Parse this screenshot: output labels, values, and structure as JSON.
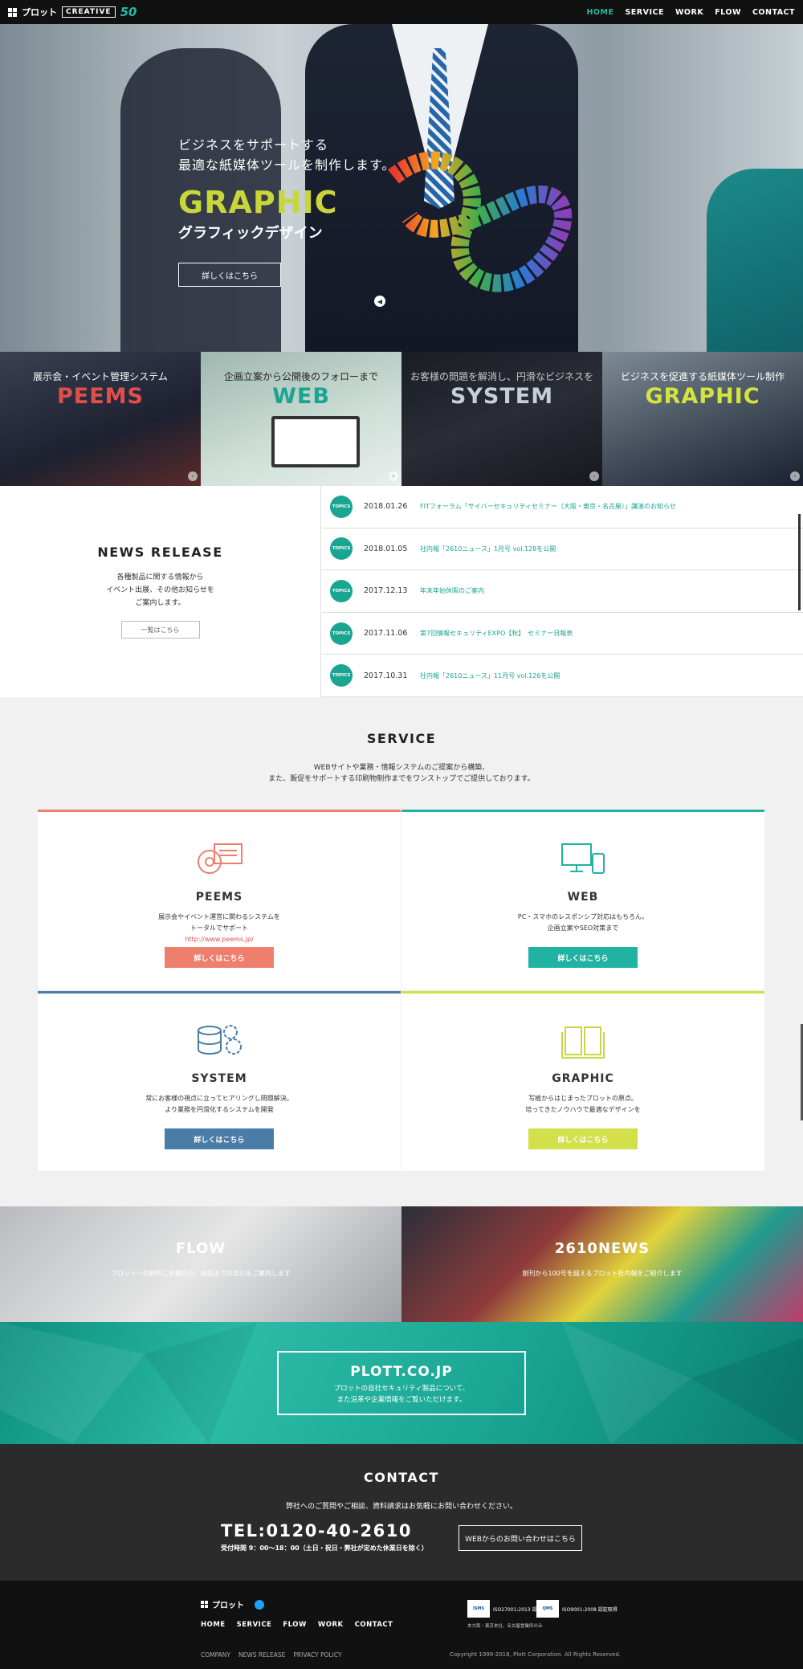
{
  "header": {
    "logo_text": "プロット",
    "creative_label": "CREATIVE",
    "anniv_label": "50",
    "nav": [
      "HOME",
      "SERVICE",
      "WORK",
      "FLOW",
      "CONTACT"
    ],
    "active": "HOME"
  },
  "hero": {
    "lead_1": "ビジネスをサポートする",
    "lead_2": "最適な紙媒体ツールを制作します。",
    "title": "GRAPHIC",
    "subtitle": "グラフィックデザイン",
    "button": "詳しくはこちら",
    "arrow": "◀"
  },
  "tiles": [
    {
      "caption": "展示会・イベント管理システム",
      "title": "PEEMS",
      "title_color": "#e0504a"
    },
    {
      "caption": "企画立案から公開後のフォローまで",
      "title": "WEB",
      "title_color": "#1aa592"
    },
    {
      "caption": "お客様の問題を解消し、円滑なビジネスを",
      "title": "SYSTEM",
      "title_color": "#c7cfd6"
    },
    {
      "caption": "ビジネスを促進する紙媒体ツール制作",
      "title": "GRAPHIC",
      "title_color": "#d5e43b"
    }
  ],
  "tile_arrow": "›",
  "news": {
    "title": "NEWS RELEASE",
    "desc_1": "各種製品に関する情報から",
    "desc_2": "イベント出展、その他お知らせを",
    "desc_3": "ご案内します。",
    "more": "一覧はこちら",
    "badge": "TOPICS",
    "items": [
      {
        "date": "2018.01.26",
        "text": "FITフォーラム「サイバーセキュリティセミナー（大阪・東京・名古屋）」講演のお知らせ"
      },
      {
        "date": "2018.01.05",
        "text": "社内報「2610ニュース」1月号 vol.128を公開"
      },
      {
        "date": "2017.12.13",
        "text": "年末年始休暇のご案内"
      },
      {
        "date": "2017.11.06",
        "text": "第7回情報セキュリティEXPO【秋】　セミナー日報表"
      },
      {
        "date": "2017.10.31",
        "text": "社内報「2610ニュース」11月号 vol.126を公開"
      }
    ]
  },
  "service": {
    "title": "SERVICE",
    "sub_1": "WEBサイトや業務・情報システムのご提案から構築、",
    "sub_2": "また、販促をサポートする印刷物制作までをワンストップでご提供しております。",
    "cards": [
      {
        "title": "PEEMS",
        "line1": "展示会やイベント運営に関わるシステムを",
        "line2": "トータルでサポート",
        "link": "http://www.peems.jp/",
        "button": "詳しくはこちら",
        "color": "#ee7f6c"
      },
      {
        "title": "WEB",
        "line1": "PC・スマホのレスポンシブ対応はもちろん。",
        "line2": "企画立案やSEO対策まで",
        "link": "",
        "button": "詳しくはこちら",
        "color": "#21b3a2"
      },
      {
        "title": "SYSTEM",
        "line1": "常にお客様の視点に立ってヒアリングし問題解決。",
        "line2": "より業務を円滑化するシステムを開発",
        "link": "",
        "button": "詳しくはこちら",
        "color": "#4a7ca8"
      },
      {
        "title": "GRAPHIC",
        "line1": "写植からはじまったプロットの原点。",
        "line2": "培ってきたノウハウで最適なデザインを",
        "link": "",
        "button": "詳しくはこちら",
        "color": "#d3e04a"
      }
    ]
  },
  "bands": [
    {
      "title": "FLOW",
      "text": "プロットへの制作ご依頼から、納品までの流れをご案内します"
    },
    {
      "title": "2610NEWS",
      "text": "創刊から100号を超えるプロット社内報をご紹介します"
    }
  ],
  "plott": {
    "title": "PLOTT.CO.JP",
    "line1": "プロットの自社セキュリティ製品について、",
    "line2": "また沿革や企業情報をご覧いただけます。"
  },
  "contact": {
    "title": "CONTACT",
    "sub": "弊社へのご質問やご相談、資料請求はお気軽にお問い合わせください。",
    "tel": "TEL:0120-40-2610",
    "hours": "受付時間 9：00〜18：00（土日・祝日・弊社が定めた休業日を除く）",
    "button": "WEBからのお問い合わせはこちら"
  },
  "footer": {
    "logo_text": "プロット",
    "nav": [
      "HOME",
      "SERVICE",
      "FLOW",
      "WORK",
      "CONTACT"
    ],
    "cert1": "ISO27001:2013 認証取得",
    "cert2": "ISO9001:2008 認証取得",
    "cert_note": "本大阪・東京本社、名古屋営業所のみ",
    "links": [
      "COMPANY",
      "NEWS RELEASE",
      "PRIVACY POLICY"
    ],
    "copyright": "Copyright 1999-2018, Plott Corporation. All Rights Reserved."
  }
}
